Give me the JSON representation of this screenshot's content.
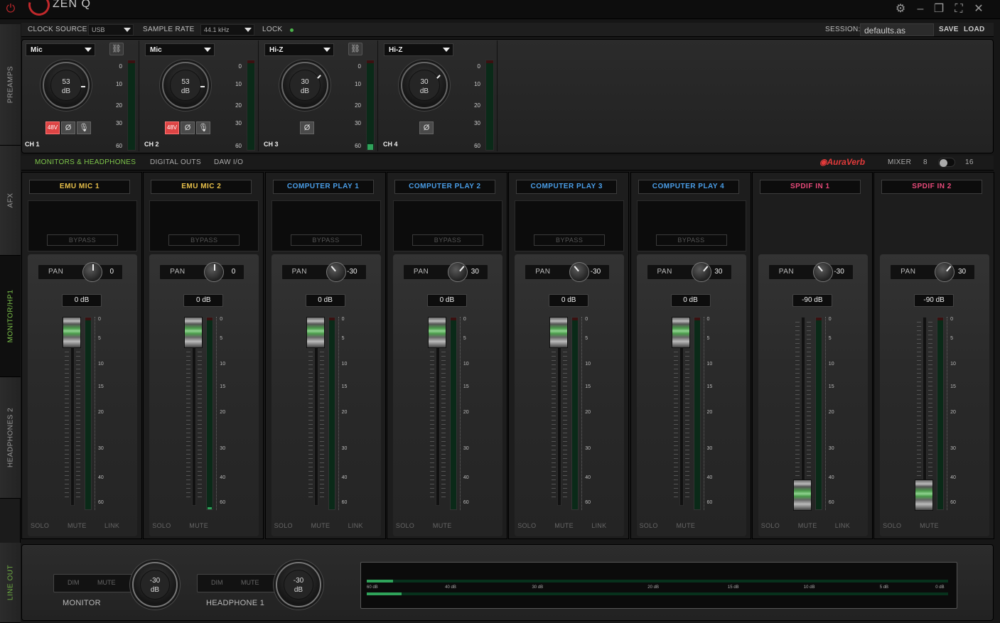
{
  "titlebar": {
    "logo": "ZEN Q"
  },
  "sidetabs": [
    "PREAMPS",
    "AFX",
    "MONITOR/HP1",
    "HEADPHONES 2",
    "LINE OUT"
  ],
  "topbar": {
    "clock_label": "CLOCK SOURCE",
    "clock_value": "USB",
    "rate_label": "SAMPLE RATE",
    "rate_value": "44.1 kHz",
    "lock_label": "LOCK",
    "session_label": "SESSION:",
    "session_value": "defaults.as",
    "save": "SAVE",
    "load": "LOAD"
  },
  "preamps": {
    "scale": [
      "0",
      "10",
      "20",
      "30",
      "60"
    ],
    "channels": [
      {
        "input": "Mic",
        "gain": "53",
        "unit": "dB",
        "label": "CH 1",
        "phantom": "48V",
        "phase": "Ø",
        "link": true,
        "phantom_on": true,
        "mic_btn": true,
        "meter": 0
      },
      {
        "input": "Mic",
        "gain": "53",
        "unit": "dB",
        "label": "CH 2",
        "phantom": "48V",
        "phase": "Ø",
        "link": false,
        "phantom_on": true,
        "mic_btn": true,
        "meter": 0
      },
      {
        "input": "Hi-Z",
        "gain": "30",
        "unit": "dB",
        "label": "CH 3",
        "phantom": "",
        "phase": "Ø",
        "link": true,
        "phantom_on": false,
        "mic_btn": false,
        "meter": 0.06
      },
      {
        "input": "Hi-Z",
        "gain": "30",
        "unit": "dB",
        "label": "CH 4",
        "phantom": "",
        "phase": "Ø",
        "link": false,
        "phantom_on": false,
        "mic_btn": false,
        "meter": 0
      }
    ]
  },
  "sections": {
    "monitors": "MONITORS & HEADPHONES",
    "digital": "DIGITAL OUTS",
    "daw": "DAW I/O",
    "auraverb": "AuraVerb",
    "mixer_label": "MIXER",
    "mixer_8": "8",
    "mixer_16": "16"
  },
  "mixer": {
    "pan_label": "PAN",
    "bypass_label": "BYPASS",
    "scale": [
      "0",
      "5",
      "10",
      "15",
      "20",
      "30",
      "40",
      "60"
    ],
    "solo": "SOLO",
    "mute": "MUTE",
    "link": "LINK",
    "strips": [
      {
        "name": "EMU MIC 1",
        "color": "#e8c04a",
        "fx": true,
        "pan": "0",
        "pan_deg": 0,
        "gain": "0 dB",
        "fader": 0.0,
        "meter": 0,
        "link": true
      },
      {
        "name": "EMU MIC 2",
        "color": "#e8c04a",
        "fx": true,
        "pan": "0",
        "pan_deg": 0,
        "gain": "0 dB",
        "fader": 0.0,
        "meter": 0.01,
        "link": false
      },
      {
        "name": "COMPUTER PLAY 1",
        "color": "#4a9ee8",
        "fx": true,
        "pan": "-30",
        "pan_deg": -40,
        "gain": "0 dB",
        "fader": 0.0,
        "meter": 0,
        "link": true
      },
      {
        "name": "COMPUTER PLAY 2",
        "color": "#4a9ee8",
        "fx": true,
        "pan": "30",
        "pan_deg": 40,
        "gain": "0 dB",
        "fader": 0.0,
        "meter": 0,
        "link": false
      },
      {
        "name": "COMPUTER PLAY 3",
        "color": "#4a9ee8",
        "fx": true,
        "pan": "-30",
        "pan_deg": -40,
        "gain": "0 dB",
        "fader": 0.0,
        "meter": 0,
        "link": true
      },
      {
        "name": "COMPUTER PLAY 4",
        "color": "#4a9ee8",
        "fx": true,
        "pan": "30",
        "pan_deg": 40,
        "gain": "0 dB",
        "fader": 0.0,
        "meter": 0,
        "link": false
      },
      {
        "name": "SPDIF IN 1",
        "color": "#e84a7a",
        "fx": false,
        "pan": "-30",
        "pan_deg": -40,
        "gain": "-90 dB",
        "fader": 0.86,
        "meter": 0,
        "link": true
      },
      {
        "name": "SPDIF IN 2",
        "color": "#e84a7a",
        "fx": false,
        "pan": "30",
        "pan_deg": 40,
        "gain": "-90 dB",
        "fader": 0.86,
        "meter": 0,
        "link": false
      }
    ]
  },
  "outputs": {
    "monitor": {
      "label": "MONITOR",
      "dim": "DIM",
      "mute": "MUTE",
      "value": "-30",
      "unit": "dB"
    },
    "headphone": {
      "label": "HEADPHONE 1",
      "dim": "DIM",
      "mute": "MUTE",
      "value": "-30",
      "unit": "dB"
    },
    "meter_scale": [
      "60 dB",
      "40 dB",
      "30 dB",
      "20 dB",
      "15 dB",
      "10 dB",
      "5 dB",
      "0 dB"
    ],
    "meter_levels": [
      0.045,
      0.06
    ]
  }
}
